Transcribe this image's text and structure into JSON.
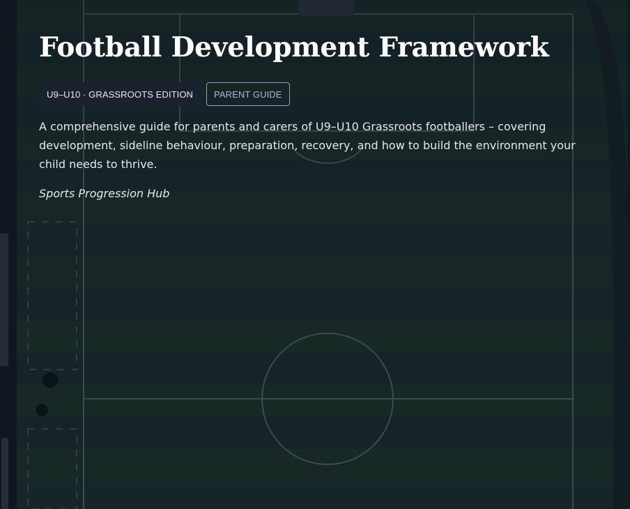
{
  "hero": {
    "title": "Football Development Framework",
    "badges": [
      {
        "label": "U9–U10 · GRASSROOTS EDITION",
        "style": "filled"
      },
      {
        "label": "PARENT GUIDE",
        "style": "outline"
      }
    ],
    "description": "A comprehensive guide for parents and carers of U9–U10 Grassroots footballers – covering development, sideline behaviour, preparation, recovery, and how to build the environment your child needs to thrive.",
    "organization": "Sports Progression Hub"
  },
  "colors": {
    "title": "#ffffff",
    "badge_filled_bg": "#1a2230",
    "badge_outline_border": "#8f9dc8",
    "badge_outline_text": "#aab6e0",
    "body_text": "#e6e8ea",
    "background": "#13221f"
  }
}
